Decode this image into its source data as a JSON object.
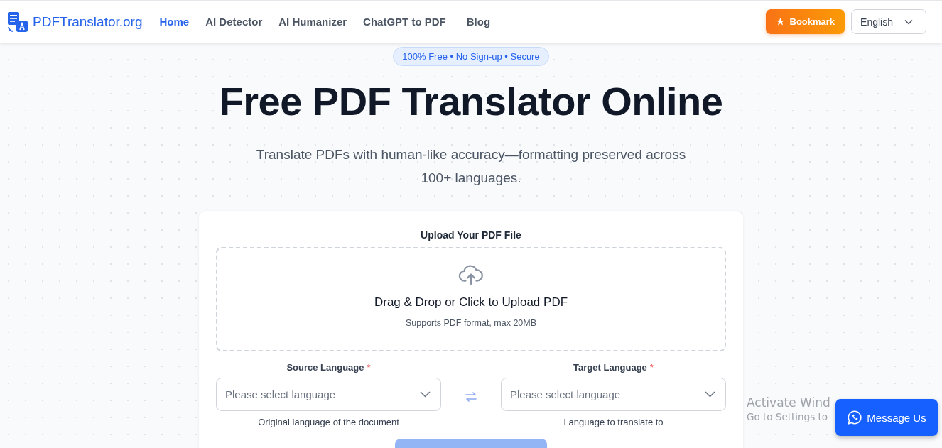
{
  "header": {
    "logo_text": "PDFTranslator.org",
    "nav": [
      {
        "label": "Home",
        "selected": true
      },
      {
        "label": "AI Detector",
        "selected": false
      },
      {
        "label": "AI Humanizer",
        "selected": false
      },
      {
        "label": "ChatGPT to PDF",
        "selected": false
      },
      {
        "label": "Blog",
        "selected": false
      }
    ],
    "bookmark_button": "Bookmark",
    "language_select": "English"
  },
  "hero": {
    "badge": "100% Free • No Sign-up • Secure",
    "title": "Free PDF Translator Online",
    "subtitle": "Translate PDFs with human-like accuracy—formatting preserved across 100+ languages."
  },
  "upload": {
    "label": "Upload Your PDF File",
    "drop_title": "Drag & Drop or Click to Upload PDF",
    "drop_hint": "Supports PDF format, max 20MB",
    "languages": [
      {
        "label": "Source Language",
        "required_mark": "*",
        "placeholder": "Please select language",
        "help": "Original language of the document"
      },
      {
        "label": "Target Language",
        "required_mark": "*",
        "placeholder": "Please select language",
        "help": "Language to translate to"
      }
    ]
  },
  "os_notice": {
    "title": "Activate Wind",
    "text": "Go to Settings to"
  },
  "chat_button": "Message Us"
}
